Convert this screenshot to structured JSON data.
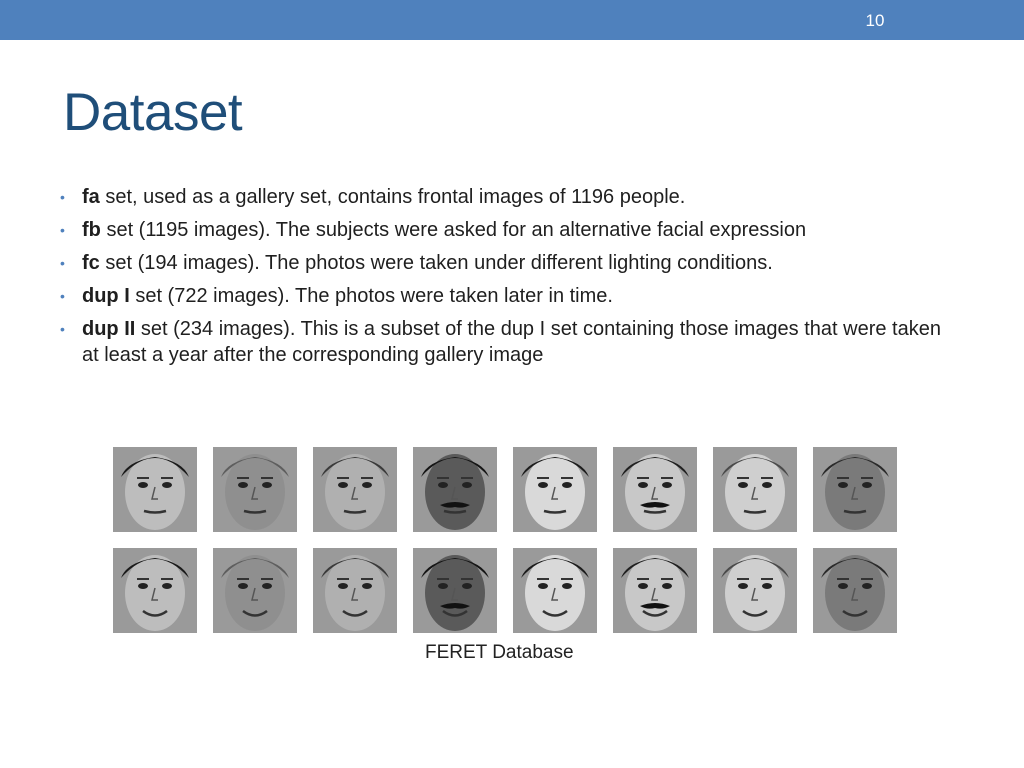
{
  "slide": {
    "number": "10",
    "title": "Dataset"
  },
  "bullets": [
    {
      "term": "fa",
      "text": " set, used as a gallery set, contains frontal images of 1196 people."
    },
    {
      "term": "fb",
      "text": " set (1195 images). The subjects were asked for an alternative facial expression"
    },
    {
      "term": "fc",
      "text": " set (194 images). The photos were taken under different lighting conditions."
    },
    {
      "term": "dup I",
      "text": " set (722 images). The photos were taken later in time."
    },
    {
      "term": "dup II",
      "text": " set (234 images). This is a subset of the dup I set containing those images that were taken at least a year after the corresponding gallery image"
    }
  ],
  "figure": {
    "caption": "FERET Database",
    "rows": 2,
    "columns": 8
  },
  "colors": {
    "accent_bar": "#4f81bd",
    "title": "#1f4e79",
    "bullet_dot": "#4f81bd"
  }
}
